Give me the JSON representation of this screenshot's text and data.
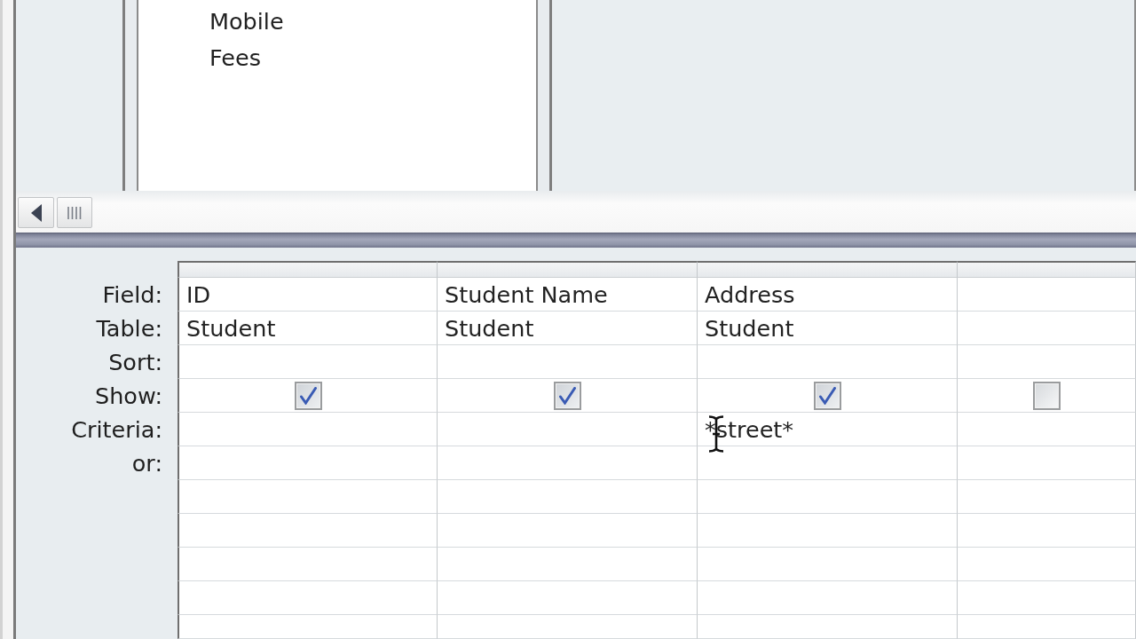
{
  "field_list": {
    "items": [
      {
        "label": "Mobile"
      },
      {
        "label": "Fees"
      }
    ]
  },
  "design_grid": {
    "rows": [
      {
        "label": "Field:",
        "kind": "field"
      },
      {
        "label": "Table:",
        "kind": "table"
      },
      {
        "label": "Sort:",
        "kind": "sort"
      },
      {
        "label": "Show:",
        "kind": "show"
      },
      {
        "label": "Criteria:",
        "kind": "criteria"
      },
      {
        "label": "or:",
        "kind": "or"
      }
    ],
    "columns": [
      {
        "field": "ID",
        "table": "Student",
        "show": true
      },
      {
        "field": "Student Name",
        "table": "Student",
        "show": true
      },
      {
        "field": "Address",
        "table": "Student",
        "show": true,
        "criteria": "*street*"
      },
      {
        "show": false
      }
    ]
  }
}
